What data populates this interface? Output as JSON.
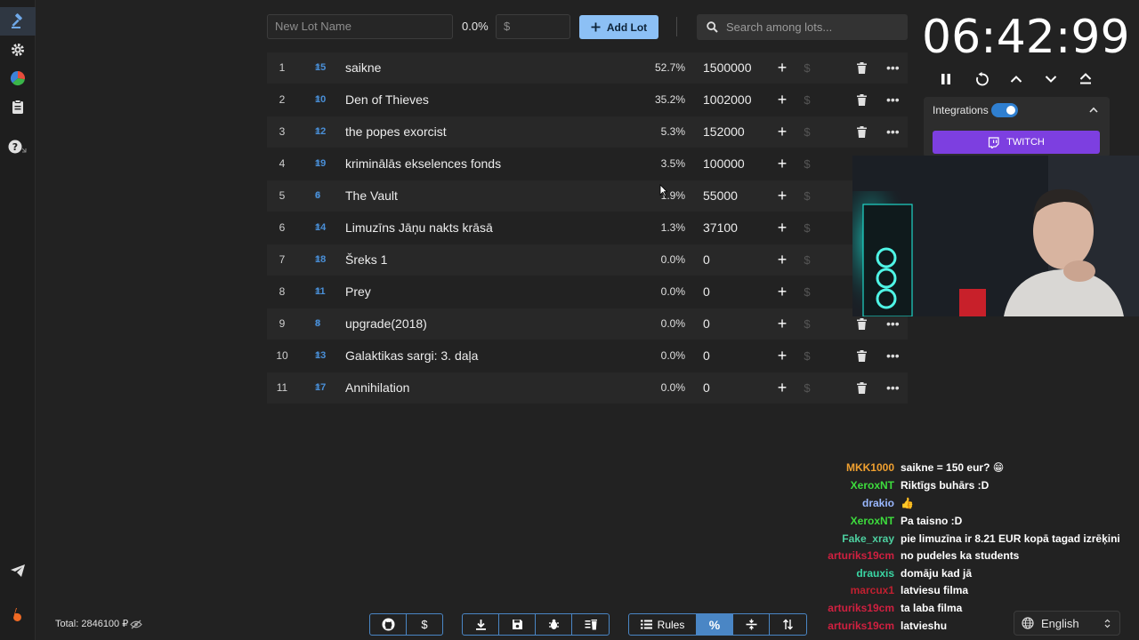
{
  "new_lot": {
    "placeholder": "New Lot Name",
    "percent": "0.0%",
    "amount_placeholder": "$",
    "add_label": "Add Lot"
  },
  "search": {
    "placeholder": "Search among lots..."
  },
  "lots": [
    {
      "index": "1",
      "id": "15",
      "name": "saikne",
      "percent": "52.7%",
      "amount": "1500000"
    },
    {
      "index": "2",
      "id": "10",
      "name": "Den of Thieves",
      "percent": "35.2%",
      "amount": "1002000"
    },
    {
      "index": "3",
      "id": "12",
      "name": "the popes exorcist",
      "percent": "5.3%",
      "amount": "152000"
    },
    {
      "index": "4",
      "id": "19",
      "name": "kriminālās ekselences fonds",
      "percent": "3.5%",
      "amount": "100000"
    },
    {
      "index": "5",
      "id": "6",
      "name": "The Vault",
      "percent": "1.9%",
      "amount": "55000"
    },
    {
      "index": "6",
      "id": "14",
      "name": "Limuzīns Jāņu nakts krāsā",
      "percent": "1.3%",
      "amount": "37100"
    },
    {
      "index": "7",
      "id": "18",
      "name": "Šreks 1",
      "percent": "0.0%",
      "amount": "0"
    },
    {
      "index": "8",
      "id": "11",
      "name": "Prey",
      "percent": "0.0%",
      "amount": "0"
    },
    {
      "index": "9",
      "id": "8",
      "name": "upgrade(2018)",
      "percent": "0.0%",
      "amount": "0"
    },
    {
      "index": "10",
      "id": "13",
      "name": "Galaktikas sargi: 3. daļa",
      "percent": "0.0%",
      "amount": "0"
    },
    {
      "index": "11",
      "id": "17",
      "name": "Annihilation",
      "percent": "0.0%",
      "amount": "0"
    }
  ],
  "timer": {
    "display": "06:42:99"
  },
  "integrations": {
    "label": "Integrations",
    "enabled": true,
    "twitch_label": "TWITCH"
  },
  "chat": [
    {
      "user": "MKK1000",
      "color": "#f0a030",
      "message": "saikne = 150 eur? 😁"
    },
    {
      "user": "XeroxNT",
      "color": "#3ddc3d",
      "message": "Riktīgs buhārs :D"
    },
    {
      "user": "drakio",
      "color": "#9ab8ff",
      "message": "👍"
    },
    {
      "user": "XeroxNT",
      "color": "#3ddc3d",
      "message": "Pa taisno :D"
    },
    {
      "user": "Fake_xray",
      "color": "#4dd0a0",
      "message": "pie limuzīna ir 8.21 EUR kopā tagad izrēķini"
    },
    {
      "user": "arturiks19cm",
      "color": "#d02040",
      "message": "no pudeles ka students"
    },
    {
      "user": "drauxis",
      "color": "#3ad6a4",
      "message": "domāju kad jā"
    },
    {
      "user": "marcux1",
      "color": "#c02030",
      "message": "latviesu filma"
    },
    {
      "user": "arturiks19cm",
      "color": "#d02040",
      "message": "ta laba filma"
    },
    {
      "user": "arturiks19cm",
      "color": "#d02040",
      "message": "latvieshu"
    }
  ],
  "footer": {
    "total": "Total: 2846100 ₽"
  },
  "toolbar": {
    "rules_label": "Rules"
  },
  "language": {
    "selected": "English"
  },
  "colors": {
    "accent": "#4a86c5",
    "add_button": "#8cc0f5",
    "twitch": "#7d3fe0",
    "lot_id": "#4a90d9"
  }
}
